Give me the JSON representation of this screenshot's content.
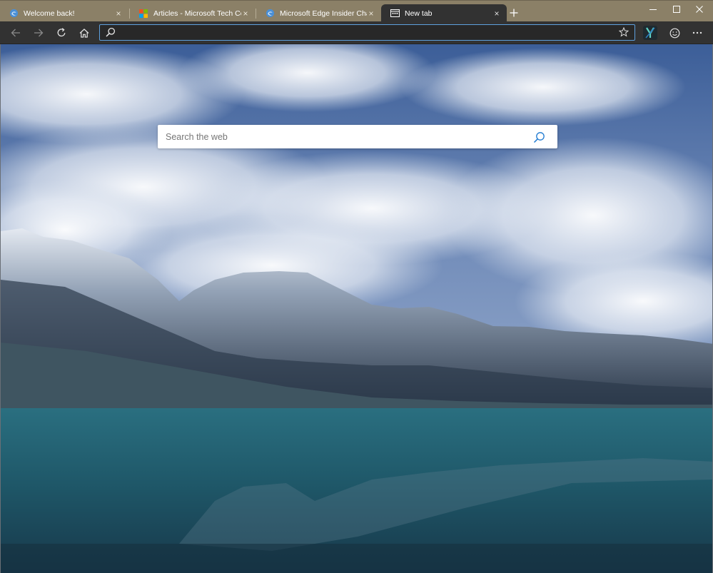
{
  "tabs": [
    {
      "label": "Welcome back!",
      "icon": "edge-logo-icon",
      "active": false
    },
    {
      "label": "Articles - Microsoft Tech Commu",
      "icon": "microsoft-logo-icon",
      "active": false
    },
    {
      "label": "Microsoft Edge Insider Channels",
      "icon": "edge-logo-icon",
      "active": false
    },
    {
      "label": "New tab",
      "icon": "new-tab-page-icon",
      "active": true
    }
  ],
  "tab_close_glyph": "×",
  "newtab_glyph": "+",
  "omnibox": {
    "value": "",
    "placeholder": ""
  },
  "web_search": {
    "placeholder": "Search the web"
  },
  "colors": {
    "accent": "#5ea1de",
    "toolbar": "#323232",
    "titlebar": "#8b8067"
  }
}
